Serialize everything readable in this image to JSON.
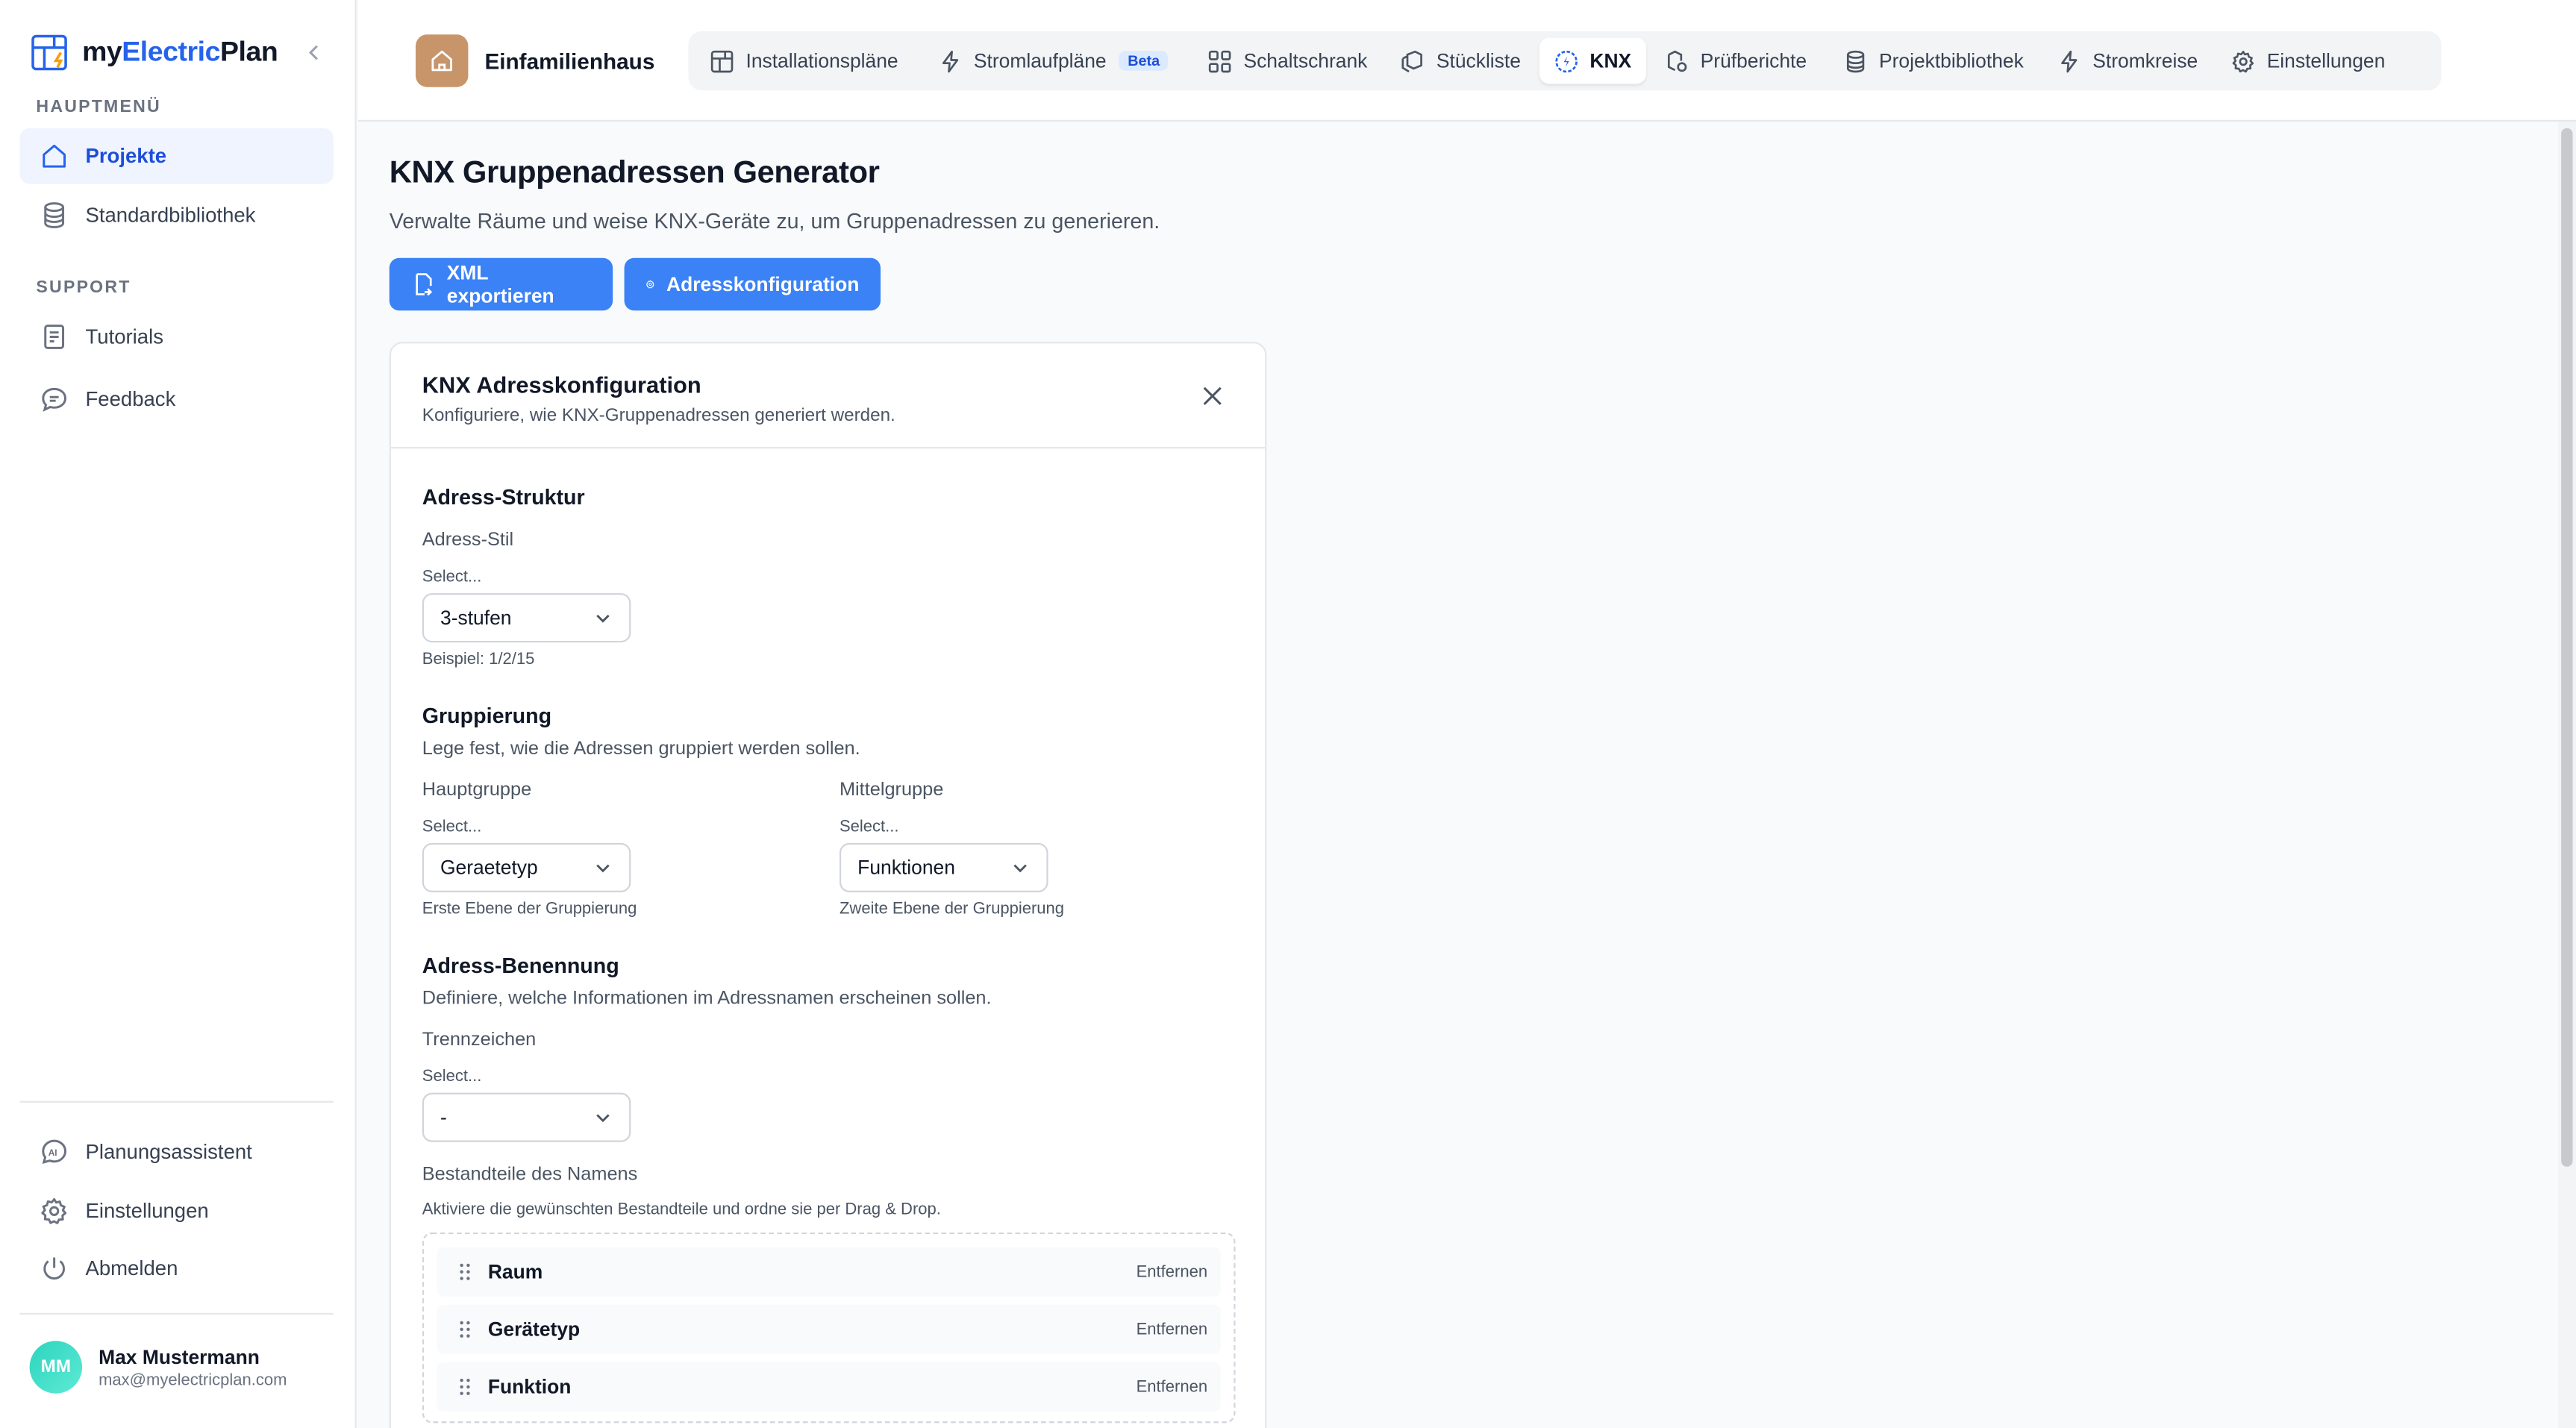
{
  "app": {
    "name_prefix": "my",
    "name_accent": "Electric",
    "name_suffix": "Plan"
  },
  "sidebar": {
    "main_heading": "HAUPTMENÜ",
    "main_items": [
      {
        "label": "Projekte",
        "icon": "home-icon",
        "active": true
      },
      {
        "label": "Standardbibliothek",
        "icon": "database-icon",
        "active": false
      }
    ],
    "support_heading": "SUPPORT",
    "support_items": [
      {
        "label": "Tutorials",
        "icon": "book-icon"
      },
      {
        "label": "Feedback",
        "icon": "message-icon"
      }
    ],
    "bottom_items": [
      {
        "label": "Planungsassistent",
        "icon": "ai-icon"
      },
      {
        "label": "Einstellungen",
        "icon": "gear-icon"
      },
      {
        "label": "Abmelden",
        "icon": "power-icon"
      }
    ],
    "user": {
      "initials": "MM",
      "name": "Max Mustermann",
      "email": "max@myelectricplan.com"
    }
  },
  "header": {
    "project_name": "Einfamilienhaus",
    "tabs": [
      {
        "label": "Installationspläne",
        "icon": "floorplan-icon"
      },
      {
        "label": "Stromlaufpläne",
        "icon": "bolt-icon",
        "badge": "Beta"
      },
      {
        "label": "Schaltschrank",
        "icon": "grid-icon"
      },
      {
        "label": "Stückliste",
        "icon": "boxes-icon"
      },
      {
        "label": "KNX",
        "icon": "knx-icon",
        "active": true
      },
      {
        "label": "Prüfberichte",
        "icon": "report-icon"
      },
      {
        "label": "Projektbibliothek",
        "icon": "database-icon"
      },
      {
        "label": "Stromkreise",
        "icon": "bolt-icon"
      },
      {
        "label": "Einstellungen",
        "icon": "gear-icon"
      }
    ]
  },
  "main": {
    "title": "KNX Gruppenadressen Generator",
    "subtitle": "Verwalte Räume und weise KNX-Geräte zu, um Gruppenadressen zu generieren.",
    "export_label": "XML exportieren",
    "config_label": "Adresskonfiguration"
  },
  "config": {
    "title": "KNX Adresskonfiguration",
    "subtitle": "Konfiguriere, wie KNX-Gruppenadressen generiert werden.",
    "structure": {
      "heading": "Adress-Struktur",
      "style_label": "Adress-Stil",
      "select_hint": "Select...",
      "style_value": "3-stufen",
      "example": "Beispiel: 1/2/15"
    },
    "grouping": {
      "heading": "Gruppierung",
      "description": "Lege fest, wie die Adressen gruppiert werden sollen.",
      "main_label": "Hauptgruppe",
      "main_hint": "Select...",
      "main_value": "Geraetetyp",
      "main_help": "Erste Ebene der Gruppierung",
      "middle_label": "Mittelgruppe",
      "middle_hint": "Select...",
      "middle_value": "Funktionen",
      "middle_help": "Zweite Ebene der Gruppierung"
    },
    "naming": {
      "heading": "Adress-Benennung",
      "description": "Definiere, welche Informationen im Adressnamen erscheinen sollen.",
      "separator_label": "Trennzeichen",
      "separator_hint": "Select...",
      "separator_value": "-",
      "parts_label": "Bestandteile des Namens",
      "parts_help": "Aktiviere die gewünschten Bestandteile und ordne sie per Drag & Drop.",
      "remove_label": "Entfernen",
      "parts": [
        "Raum",
        "Gerätetyp",
        "Funktion"
      ]
    }
  },
  "colors": {
    "accent": "#3b82f6",
    "active_bg": "#eff4ff",
    "avatar": "#2dd4bf",
    "project_icon": "#c8956a"
  }
}
